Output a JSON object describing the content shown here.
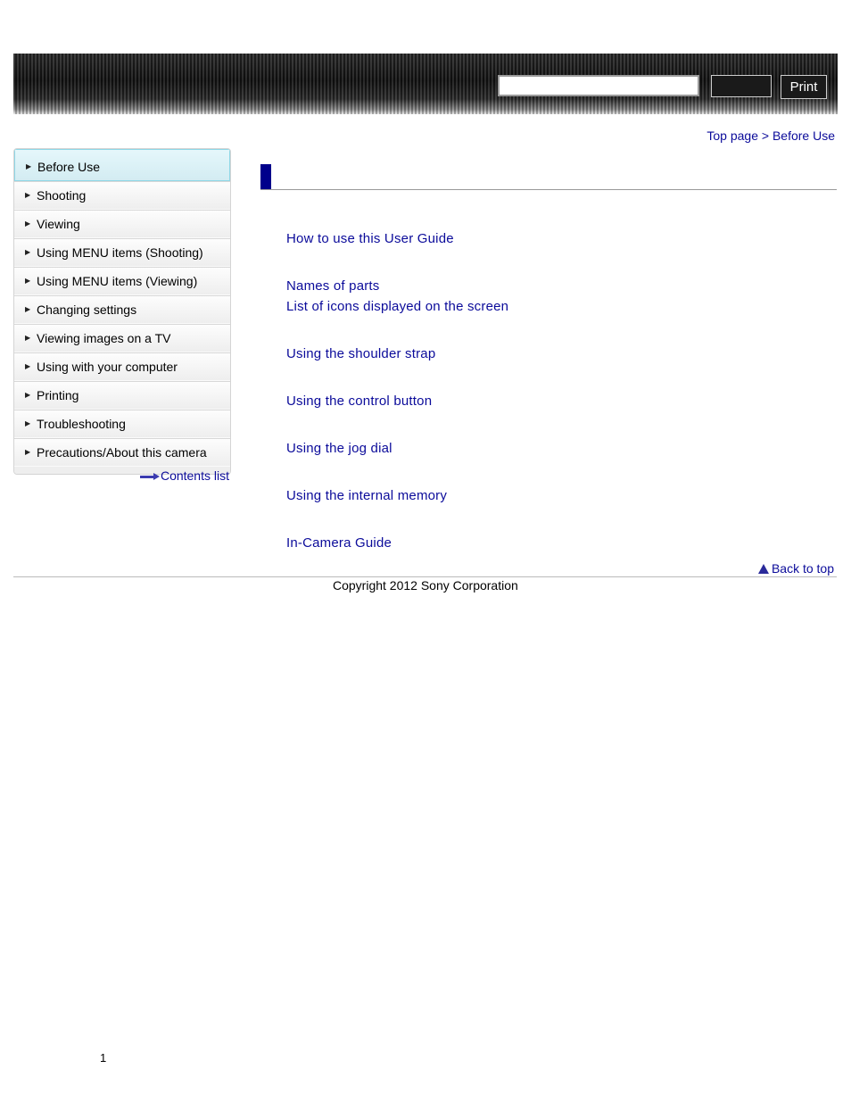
{
  "header": {
    "search_value": "",
    "search_button_label": "",
    "print_label": "Print"
  },
  "breadcrumb": {
    "top": "Top page",
    "separator": ">",
    "current": "Before Use"
  },
  "sidebar": {
    "items": [
      {
        "label": "Before Use"
      },
      {
        "label": "Shooting"
      },
      {
        "label": "Viewing"
      },
      {
        "label": "Using MENU items (Shooting)"
      },
      {
        "label": "Using MENU items (Viewing)"
      },
      {
        "label": "Changing settings"
      },
      {
        "label": "Viewing images on a TV"
      },
      {
        "label": "Using with your computer"
      },
      {
        "label": "Printing"
      },
      {
        "label": "Troubleshooting"
      },
      {
        "label": "Precautions/About this camera"
      }
    ],
    "contents_list": "Contents list"
  },
  "main": {
    "links": [
      "How to use this User Guide",
      "Names of parts",
      "List of icons displayed on the screen",
      "Using the shoulder strap",
      "Using the control button",
      "Using the jog dial",
      "Using the internal memory",
      "In-Camera Guide"
    ],
    "back_to_top": "Back to top"
  },
  "footer": {
    "copyright": "Copyright 2012 Sony Corporation",
    "page_number": "1"
  }
}
